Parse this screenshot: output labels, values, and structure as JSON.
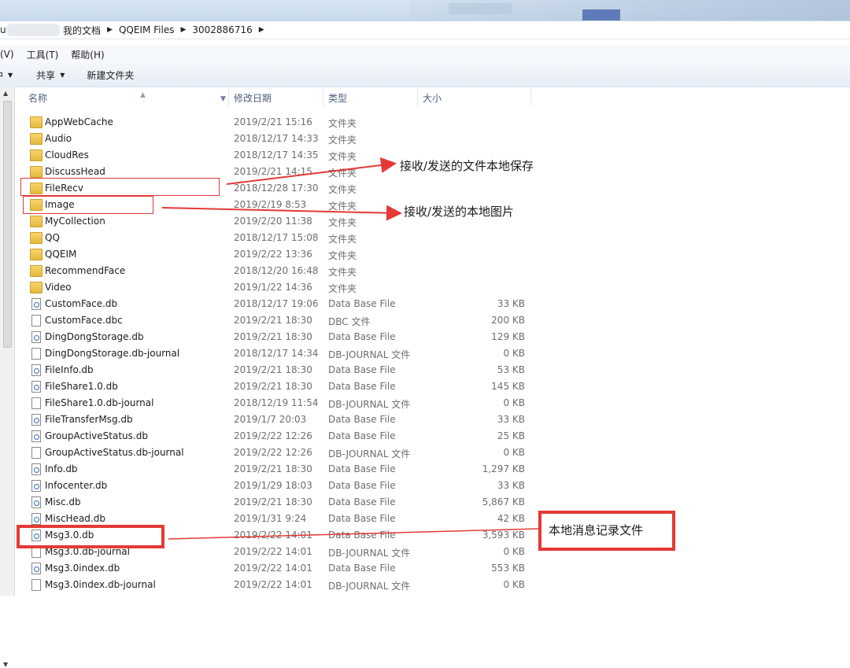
{
  "address": {
    "head_char": "u",
    "crumbs": [
      "我的文档",
      "QQEIM Files",
      "3002886716"
    ]
  },
  "menu": {
    "view": "(V)",
    "tools": "工具(T)",
    "help": "帮助(H)"
  },
  "toolbar": {
    "left_fragment": "中",
    "share": "共享",
    "new_folder": "新建文件夹"
  },
  "columns": {
    "name": "名称",
    "date": "修改日期",
    "type": "类型",
    "size": "大小"
  },
  "files": [
    {
      "name": "AppWebCache",
      "date": "2019/2/21 15:16",
      "type": "文件夹",
      "size": "",
      "icon": "folder-icon"
    },
    {
      "name": "Audio",
      "date": "2018/12/17 14:33",
      "type": "文件夹",
      "size": "",
      "icon": "folder-icon"
    },
    {
      "name": "CloudRes",
      "date": "2018/12/17 14:35",
      "type": "文件夹",
      "size": "",
      "icon": "folder-icon"
    },
    {
      "name": "DiscussHead",
      "date": "2019/2/21 14:15",
      "type": "文件夹",
      "size": "",
      "icon": "folder-icon"
    },
    {
      "name": "FileRecv",
      "date": "2018/12/28 17:30",
      "type": "文件夹",
      "size": "",
      "icon": "folder-icon"
    },
    {
      "name": "Image",
      "date": "2019/2/19 8:53",
      "type": "文件夹",
      "size": "",
      "icon": "folder-icon"
    },
    {
      "name": "MyCollection",
      "date": "2019/2/20 11:38",
      "type": "文件夹",
      "size": "",
      "icon": "folder-icon"
    },
    {
      "name": "QQ",
      "date": "2018/12/17 15:08",
      "type": "文件夹",
      "size": "",
      "icon": "folder-icon"
    },
    {
      "name": "QQEIM",
      "date": "2019/2/22 13:36",
      "type": "文件夹",
      "size": "",
      "icon": "folder-icon"
    },
    {
      "name": "RecommendFace",
      "date": "2018/12/20 16:48",
      "type": "文件夹",
      "size": "",
      "icon": "folder-icon"
    },
    {
      "name": "Video",
      "date": "2019/1/22 14:36",
      "type": "文件夹",
      "size": "",
      "icon": "folder-icon"
    },
    {
      "name": "CustomFace.db",
      "date": "2018/12/17 19:06",
      "type": "Data Base File",
      "size": "33 KB",
      "icon": "database-file-icon"
    },
    {
      "name": "CustomFace.dbc",
      "date": "2019/2/21 18:30",
      "type": "DBC 文件",
      "size": "200 KB",
      "icon": "blank-file-icon"
    },
    {
      "name": "DingDongStorage.db",
      "date": "2019/2/21 18:30",
      "type": "Data Base File",
      "size": "129 KB",
      "icon": "database-file-icon"
    },
    {
      "name": "DingDongStorage.db-journal",
      "date": "2018/12/17 14:34",
      "type": "DB-JOURNAL 文件",
      "size": "0 KB",
      "icon": "blank-file-icon"
    },
    {
      "name": "FileInfo.db",
      "date": "2019/2/21 18:30",
      "type": "Data Base File",
      "size": "53 KB",
      "icon": "database-file-icon"
    },
    {
      "name": "FileShare1.0.db",
      "date": "2019/2/21 18:30",
      "type": "Data Base File",
      "size": "145 KB",
      "icon": "database-file-icon"
    },
    {
      "name": "FileShare1.0.db-journal",
      "date": "2018/12/19 11:54",
      "type": "DB-JOURNAL 文件",
      "size": "0 KB",
      "icon": "blank-file-icon"
    },
    {
      "name": "FileTransferMsg.db",
      "date": "2019/1/7 20:03",
      "type": "Data Base File",
      "size": "33 KB",
      "icon": "database-file-icon"
    },
    {
      "name": "GroupActiveStatus.db",
      "date": "2019/2/22 12:26",
      "type": "Data Base File",
      "size": "25 KB",
      "icon": "database-file-icon"
    },
    {
      "name": "GroupActiveStatus.db-journal",
      "date": "2019/2/22 12:26",
      "type": "DB-JOURNAL 文件",
      "size": "0 KB",
      "icon": "blank-file-icon"
    },
    {
      "name": "Info.db",
      "date": "2019/2/21 18:30",
      "type": "Data Base File",
      "size": "1,297 KB",
      "icon": "database-file-icon"
    },
    {
      "name": "Infocenter.db",
      "date": "2019/1/29 18:03",
      "type": "Data Base File",
      "size": "33 KB",
      "icon": "database-file-icon"
    },
    {
      "name": "Misc.db",
      "date": "2019/2/21 18:30",
      "type": "Data Base File",
      "size": "5,867 KB",
      "icon": "database-file-icon"
    },
    {
      "name": "MiscHead.db",
      "date": "2019/1/31 9:24",
      "type": "Data Base File",
      "size": "42 KB",
      "icon": "database-file-icon"
    },
    {
      "name": "Msg3.0.db",
      "date": "2019/2/22 14:01",
      "type": "Data Base File",
      "size": "3,593 KB",
      "icon": "database-file-icon"
    },
    {
      "name": "Msg3.0.db-journal",
      "date": "2019/2/22 14:01",
      "type": "DB-JOURNAL 文件",
      "size": "0 KB",
      "icon": "blank-file-icon"
    },
    {
      "name": "Msg3.0index.db",
      "date": "2019/2/22 14:01",
      "type": "Data Base File",
      "size": "553 KB",
      "icon": "database-file-icon"
    },
    {
      "name": "Msg3.0index.db-journal",
      "date": "2019/2/22 14:01",
      "type": "DB-JOURNAL 文件",
      "size": "0 KB",
      "icon": "blank-file-icon"
    }
  ],
  "annotations": {
    "filerecv_note": "接收/发送的文件本地保存",
    "image_note": "接收/发送的本地图片",
    "msg_note": "本地消息记录文件",
    "color": "#e53935"
  }
}
